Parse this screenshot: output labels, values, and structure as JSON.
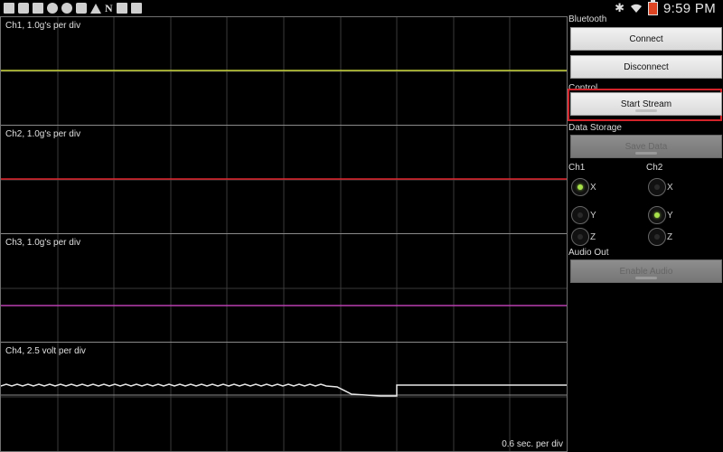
{
  "status": {
    "time": "9:59 PM",
    "notif_letter": "N"
  },
  "scope": {
    "panels": [
      {
        "label": "Ch1, 1.0g's per div",
        "color": "#c9d63a",
        "level": 0.49
      },
      {
        "label": "Ch2, 1.0g's per div",
        "color": "#e3262d",
        "level": 0.49
      },
      {
        "label": "Ch3, 1.0g's per div",
        "color": "#b93fb0",
        "level": 0.66
      },
      {
        "label": "Ch4, 2.5 volt per div",
        "color": "#e8e8e8",
        "level": 0.39
      }
    ],
    "time_scale": "0.6 sec. per div"
  },
  "controls": {
    "bluetooth_label": "Bluetooth",
    "connect": "Connect",
    "disconnect": "Disconnect",
    "control_label": "Control",
    "start_stream": "Start Stream",
    "data_storage_label": "Data Storage",
    "save_data": "Save Data",
    "ch1_label": "Ch1",
    "ch2_label": "Ch2",
    "audio_out_label": "Audio Out",
    "enable_audio": "Enable Audio",
    "axes": [
      "X",
      "Y",
      "Z"
    ],
    "ch1_selected": "X",
    "ch2_selected": "Y"
  }
}
